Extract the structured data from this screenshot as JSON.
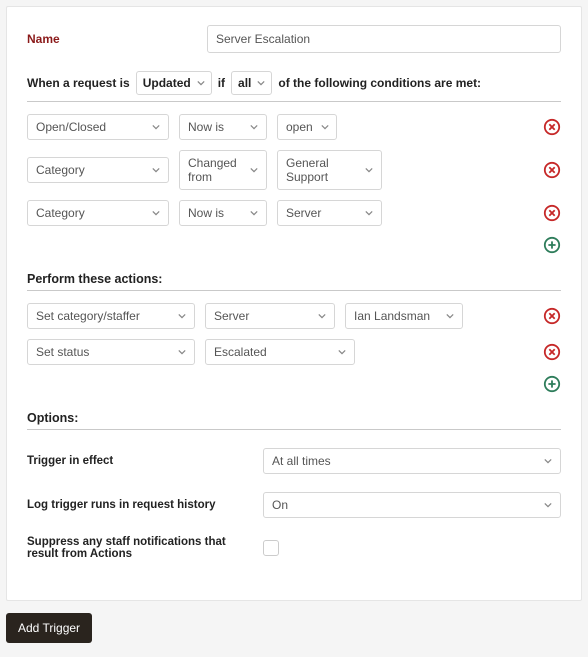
{
  "nameLabel": "Name",
  "nameValue": "Server Escalation",
  "sentence": {
    "p1": "When a request is",
    "eventValue": "Updated",
    "p2": "if",
    "matchValue": "all",
    "p3": "of the following conditions are met:"
  },
  "conditions": [
    {
      "field": "Open/Closed",
      "op": "Now is",
      "val": "open",
      "valW": "w-d"
    },
    {
      "field": "Category",
      "op": "Changed from",
      "val": "General Support",
      "valW": "w-c"
    },
    {
      "field": "Category",
      "op": "Now is",
      "val": "Server",
      "valW": "w-c"
    }
  ],
  "actionsTitle": "Perform these actions:",
  "actions": [
    {
      "type": "Set category/staffer",
      "v1": "Server",
      "v2": "Ian Landsman"
    },
    {
      "type": "Set status",
      "v1": "Escalated"
    }
  ],
  "optionsTitle": "Options:",
  "options": {
    "effectLabel": "Trigger in effect",
    "effectValue": "At all times",
    "logLabel": "Log trigger runs in request history",
    "logValue": "On",
    "suppressLabel": "Suppress any staff notifications that result from Actions"
  },
  "addTriggerLabel": "Add Trigger"
}
